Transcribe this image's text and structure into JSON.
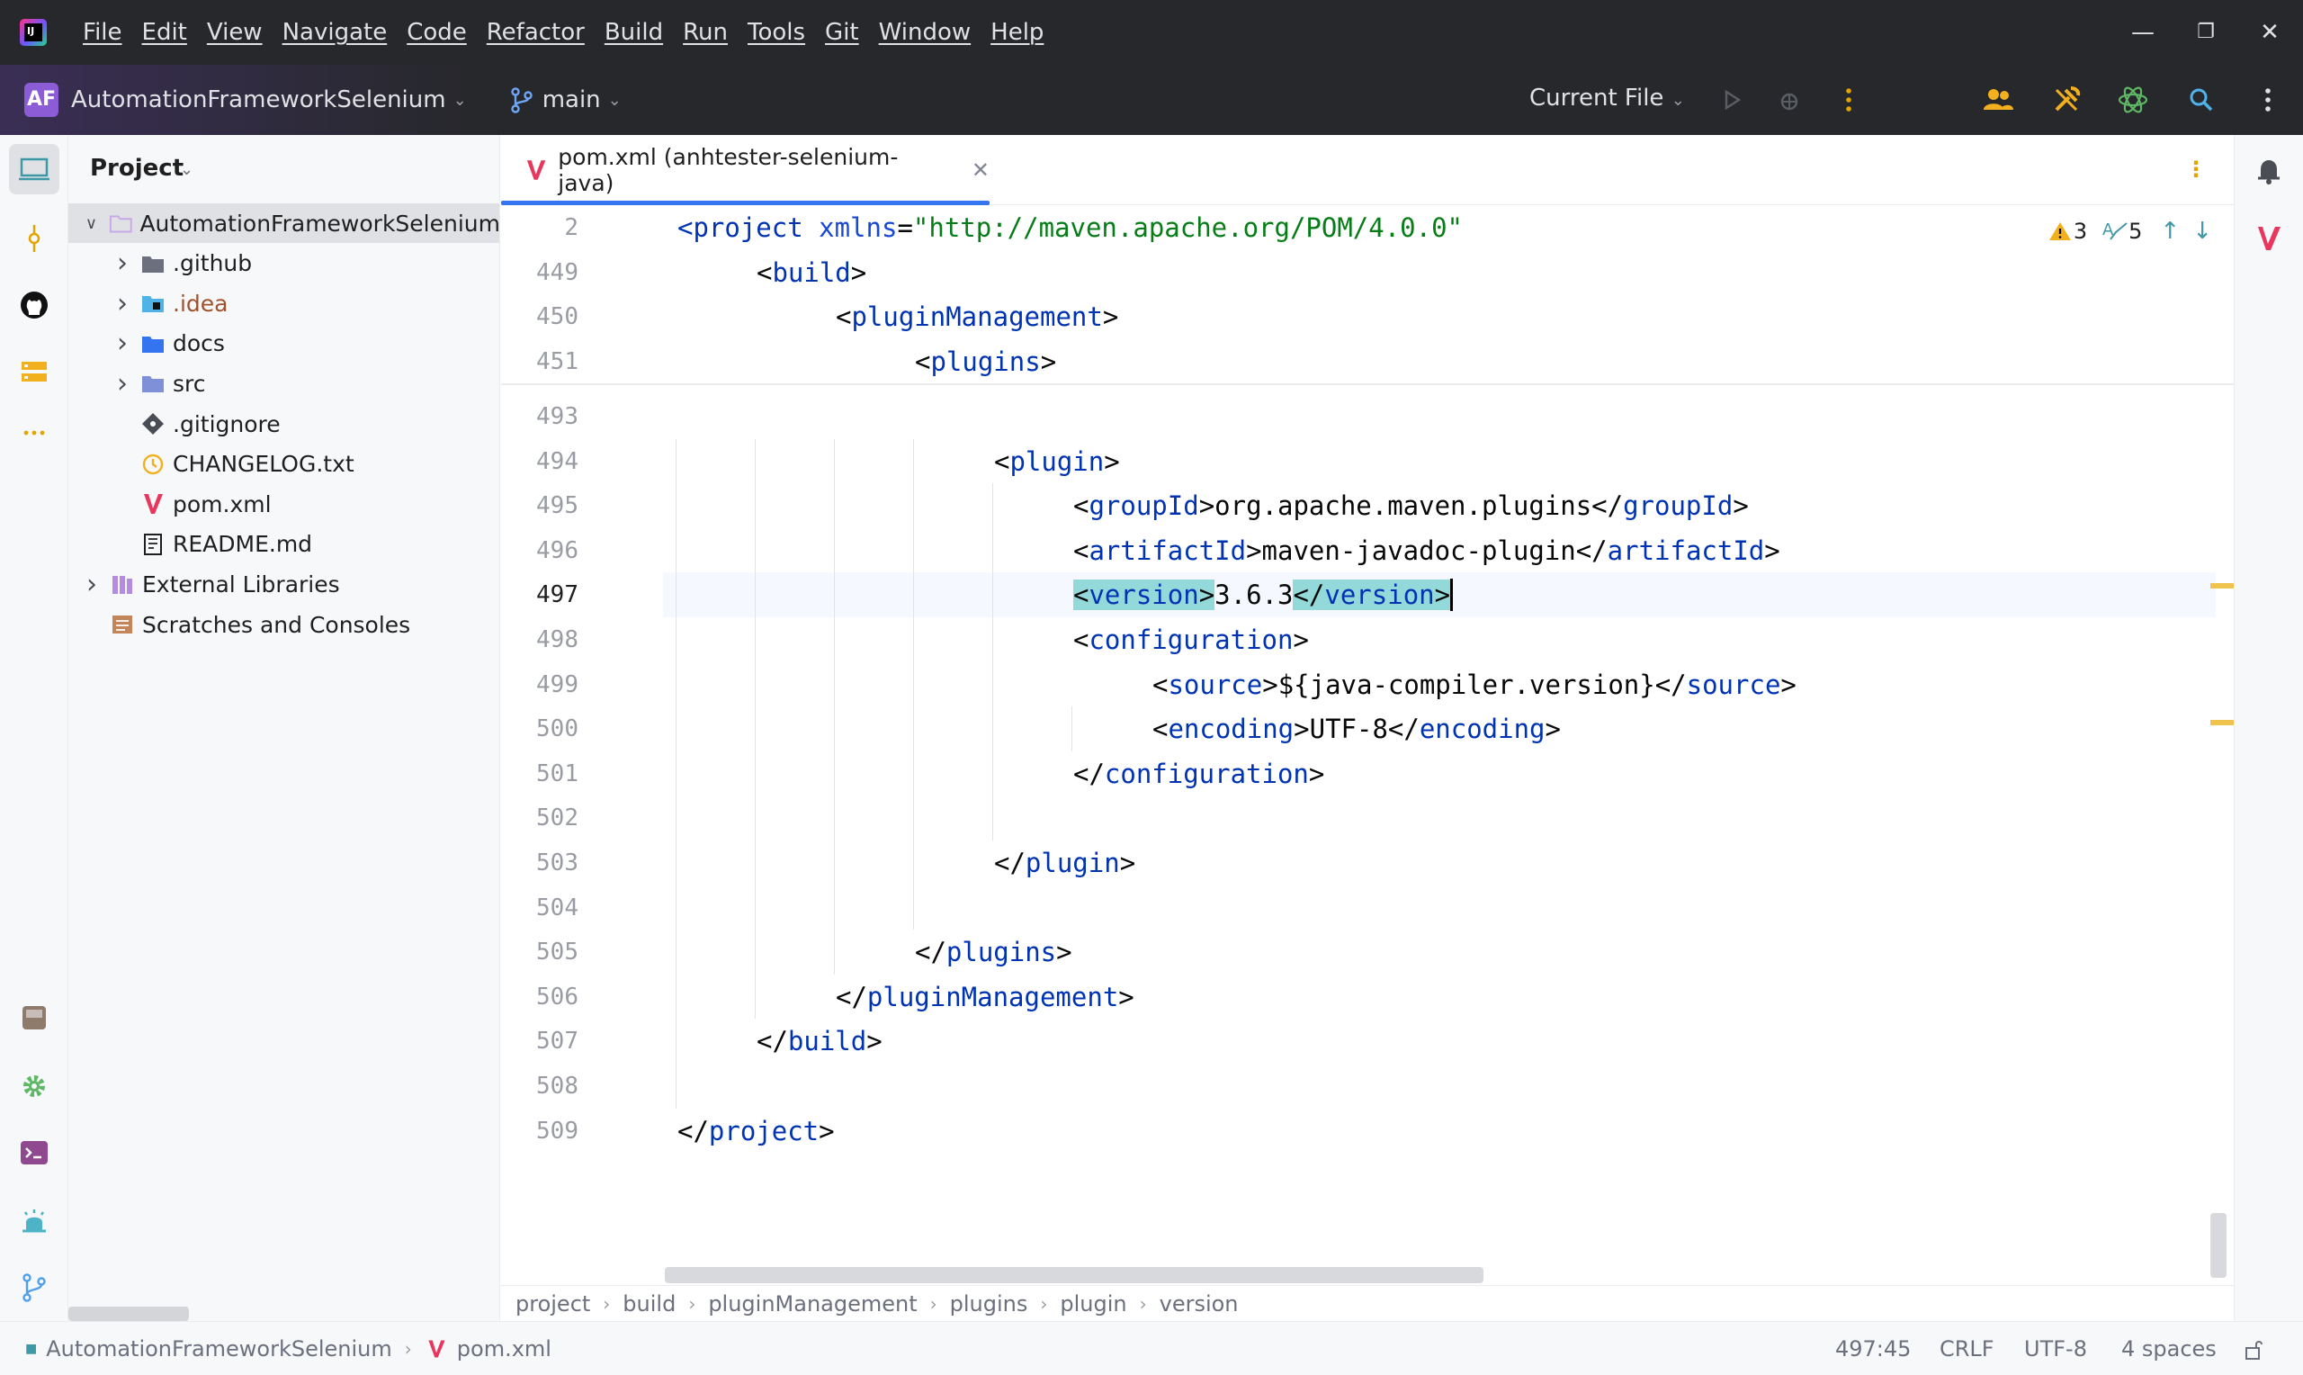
{
  "menu": {
    "items": [
      "File",
      "Edit",
      "View",
      "Navigate",
      "Code",
      "Refactor",
      "Build",
      "Run",
      "Tools",
      "Git",
      "Window",
      "Help"
    ]
  },
  "toolbar": {
    "project_badge": "AF",
    "project_name": "AutomationFrameworkSelenium",
    "branch": "main",
    "run_config": "Current File"
  },
  "project_panel": {
    "title": "Project",
    "tree": [
      {
        "label": "AutomationFrameworkSelenium",
        "icon": "folder-icon",
        "depth": 0,
        "arrow": "expanded",
        "selected": true
      },
      {
        "label": ".github",
        "icon": "folder-github-icon",
        "depth": 1,
        "arrow": "collapsed"
      },
      {
        "label": ".idea",
        "icon": "folder-idea-icon",
        "depth": 1,
        "arrow": "collapsed",
        "color": "#a0522d"
      },
      {
        "label": "docs",
        "icon": "folder-docs-icon",
        "depth": 1,
        "arrow": "collapsed"
      },
      {
        "label": "src",
        "icon": "folder-src-icon",
        "depth": 1,
        "arrow": "collapsed"
      },
      {
        "label": ".gitignore",
        "icon": "gitignore-icon",
        "depth": 1,
        "arrow": "none"
      },
      {
        "label": "CHANGELOG.txt",
        "icon": "changelog-icon",
        "depth": 1,
        "arrow": "none"
      },
      {
        "label": "pom.xml",
        "icon": "maven-icon",
        "depth": 1,
        "arrow": "none"
      },
      {
        "label": "README.md",
        "icon": "readme-icon",
        "depth": 1,
        "arrow": "none"
      },
      {
        "label": "External Libraries",
        "icon": "libraries-icon",
        "depth": 0,
        "arrow": "collapsed"
      },
      {
        "label": "Scratches and Consoles",
        "icon": "scratches-icon",
        "depth": 0,
        "arrow": "none"
      }
    ]
  },
  "editor": {
    "tab_label": "pom.xml (anhtester-selenium-java)",
    "inspections": {
      "warnings": "3",
      "typos": "5"
    },
    "sticky_lines": [
      {
        "num": "2",
        "segments": [
          [
            "t",
            "<project "
          ],
          [
            "a",
            "xmlns"
          ],
          [
            "p",
            "="
          ],
          [
            "s",
            "\"http://maven.apache.org/POM/4.0.0\""
          ]
        ],
        "indent": 0
      },
      {
        "num": "449",
        "segments": [
          [
            "p",
            "<"
          ],
          [
            "t",
            "build"
          ],
          [
            "p",
            ">"
          ]
        ],
        "indent": 1
      },
      {
        "num": "450",
        "segments": [
          [
            "p",
            "<"
          ],
          [
            "t",
            "pluginManagement"
          ],
          [
            "p",
            ">"
          ]
        ],
        "indent": 2
      },
      {
        "num": "451",
        "segments": [
          [
            "p",
            "<"
          ],
          [
            "t",
            "plugins"
          ],
          [
            "p",
            ">"
          ]
        ],
        "indent": 3
      }
    ],
    "lines": [
      {
        "num": "493",
        "segments": [],
        "indent": 0
      },
      {
        "num": "494",
        "segments": [
          [
            "p",
            "<"
          ],
          [
            "t",
            "plugin"
          ],
          [
            "p",
            ">"
          ]
        ],
        "indent": 4
      },
      {
        "num": "495",
        "segments": [
          [
            "p",
            "<"
          ],
          [
            "t",
            "groupId"
          ],
          [
            "p",
            ">org.apache.maven.plugins</"
          ],
          [
            "t",
            "groupId"
          ],
          [
            "p",
            ">"
          ]
        ],
        "indent": 5
      },
      {
        "num": "496",
        "segments": [
          [
            "p",
            "<"
          ],
          [
            "t",
            "artifactId"
          ],
          [
            "p",
            ">maven-javadoc-plugin</"
          ],
          [
            "t",
            "artifactId"
          ],
          [
            "p",
            ">"
          ]
        ],
        "indent": 5
      },
      {
        "num": "497",
        "segments": [
          [
            "h",
            "<"
          ],
          [
            "ht",
            "version"
          ],
          [
            "h",
            ">"
          ],
          [
            "p",
            "3.6.3"
          ],
          [
            "h",
            "</"
          ],
          [
            "ht",
            "version"
          ],
          [
            "h",
            ">"
          ]
        ],
        "indent": 5,
        "current": true
      },
      {
        "num": "498",
        "segments": [
          [
            "p",
            "<"
          ],
          [
            "t",
            "configuration"
          ],
          [
            "p",
            ">"
          ]
        ],
        "indent": 5
      },
      {
        "num": "499",
        "segments": [
          [
            "p",
            "<"
          ],
          [
            "t",
            "source"
          ],
          [
            "p",
            ">${java-compiler.version}</"
          ],
          [
            "t",
            "source"
          ],
          [
            "p",
            ">"
          ]
        ],
        "indent": 6
      },
      {
        "num": "500",
        "segments": [
          [
            "p",
            "<"
          ],
          [
            "t",
            "encoding"
          ],
          [
            "p",
            ">UTF-8</"
          ],
          [
            "t",
            "encoding"
          ],
          [
            "p",
            ">"
          ]
        ],
        "indent": 6
      },
      {
        "num": "501",
        "segments": [
          [
            "p",
            "</"
          ],
          [
            "t",
            "configuration"
          ],
          [
            "p",
            ">"
          ]
        ],
        "indent": 5
      },
      {
        "num": "502",
        "segments": [],
        "indent": 0
      },
      {
        "num": "503",
        "segments": [
          [
            "p",
            "</"
          ],
          [
            "t",
            "plugin"
          ],
          [
            "p",
            ">"
          ]
        ],
        "indent": 4
      },
      {
        "num": "504",
        "segments": [],
        "indent": 0
      },
      {
        "num": "505",
        "segments": [
          [
            "p",
            "</"
          ],
          [
            "t",
            "plugins"
          ],
          [
            "p",
            ">"
          ]
        ],
        "indent": 3
      },
      {
        "num": "506",
        "segments": [
          [
            "p",
            "</"
          ],
          [
            "t",
            "pluginManagement"
          ],
          [
            "p",
            ">"
          ]
        ],
        "indent": 2
      },
      {
        "num": "507",
        "segments": [
          [
            "p",
            "</"
          ],
          [
            "t",
            "build"
          ],
          [
            "p",
            ">"
          ]
        ],
        "indent": 1
      },
      {
        "num": "508",
        "segments": [],
        "indent": 0
      },
      {
        "num": "509",
        "segments": [
          [
            "p",
            "</"
          ],
          [
            "t",
            "project"
          ],
          [
            "p",
            ">"
          ]
        ],
        "indent": 0
      }
    ],
    "breadcrumbs": [
      "project",
      "build",
      "pluginManagement",
      "plugins",
      "plugin",
      "version"
    ]
  },
  "status": {
    "project": "AutomationFrameworkSelenium",
    "file": "pom.xml",
    "position": "497:45",
    "line_sep": "CRLF",
    "encoding": "UTF-8",
    "indent": "4 spaces"
  },
  "colors": {
    "tag": "#0033b3",
    "string": "#067d17",
    "tag_highlight": "#93d9d9",
    "accent": "#3574f0",
    "maven": "#e8365d"
  }
}
